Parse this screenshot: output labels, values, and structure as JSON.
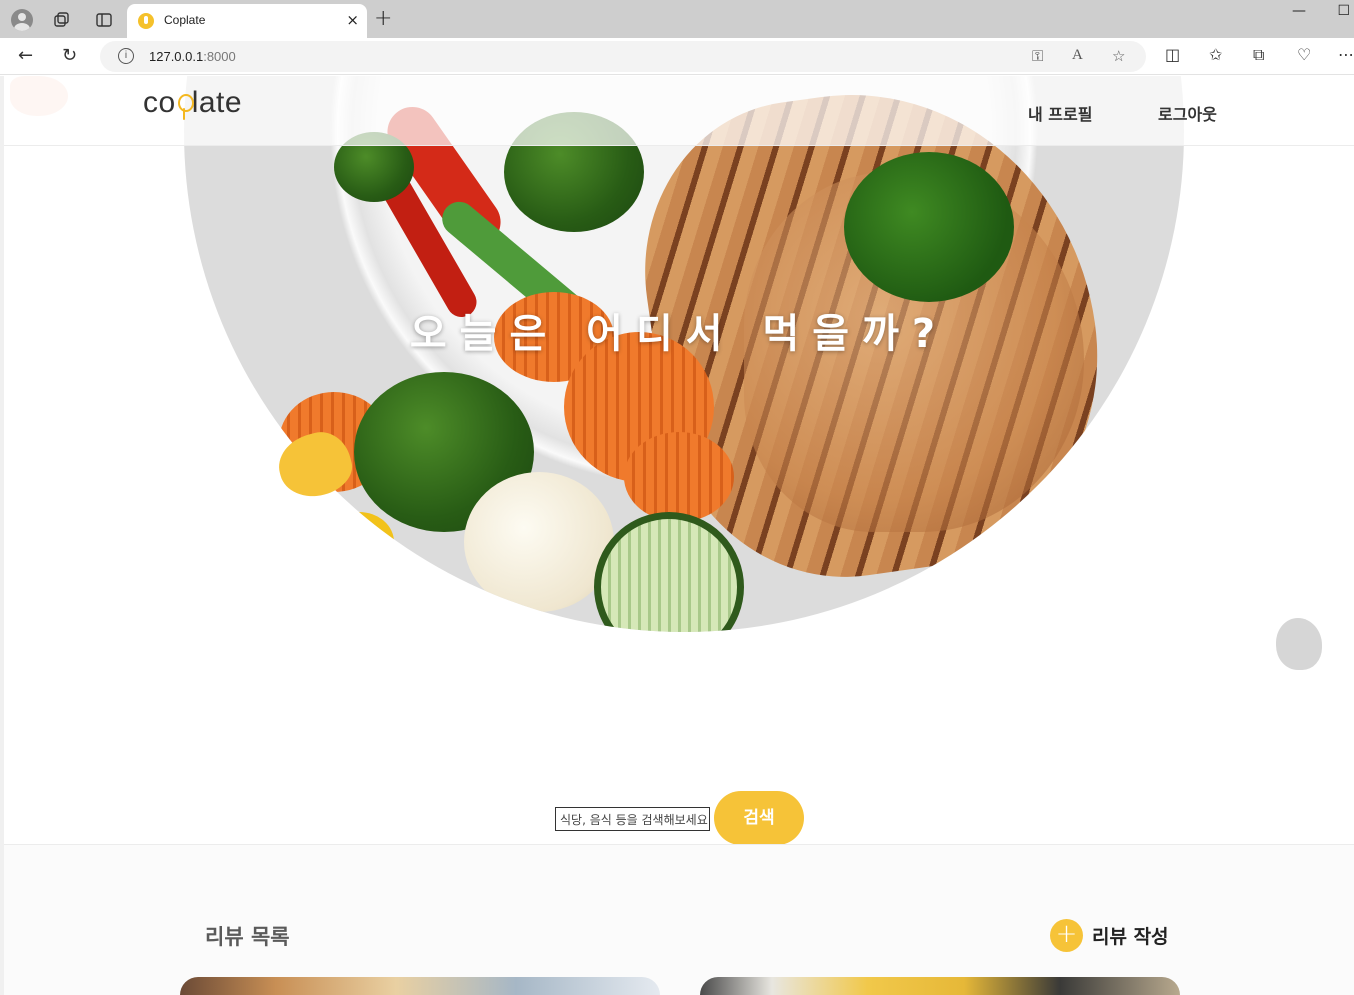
{
  "browser": {
    "tab_title": "Coplate",
    "tab_close": "×",
    "new_tab": "+",
    "url_host": "127.0.0.1",
    "url_port": ":8000",
    "icons": [
      "profile-icon",
      "collections-icon",
      "tab-actions-icon",
      "back-icon",
      "reload-icon",
      "site-info-icon",
      "key-icon",
      "read-aloud-icon",
      "favorite-icon",
      "split-screen-icon",
      "favorites-icon",
      "collections-icon",
      "browser-essentials-icon",
      "more-icon"
    ]
  },
  "header": {
    "logo_left": "co",
    "logo_right": "late",
    "nav": {
      "profile": "내 프로필",
      "logout": "로그아웃"
    }
  },
  "hero": {
    "title": "오늘은 어디서 먹을까?"
  },
  "search": {
    "placeholder": "식당, 음식 등을 검색해보세요",
    "button": "검색"
  },
  "reviews": {
    "title": "리뷰 목록",
    "write_button": "리뷰 작성",
    "write_icon": "+"
  },
  "colors": {
    "accent": "#f6c338",
    "peach": "#f8d9cf",
    "gray_blob": "#d6d6d6"
  }
}
